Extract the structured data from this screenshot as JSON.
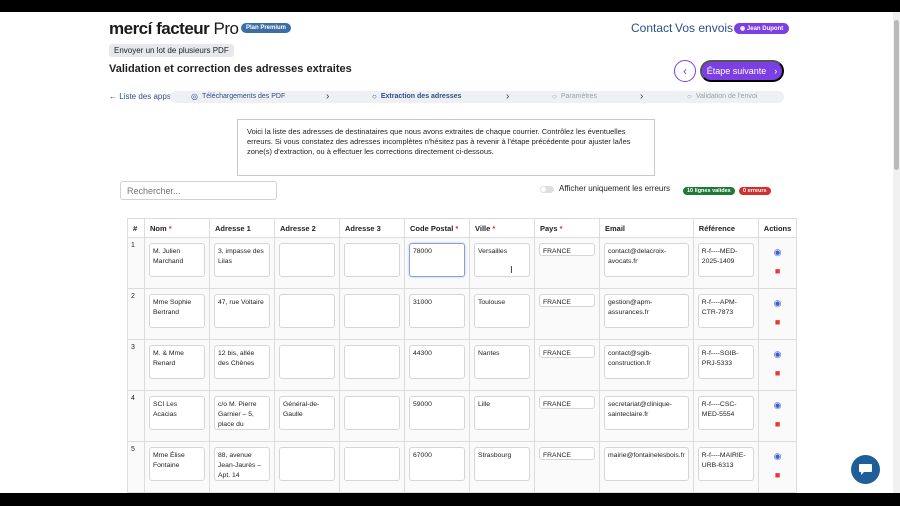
{
  "header": {
    "logo_main": "mercí facteur",
    "logo_pro": " Pro",
    "plan_badge": "Plan Premium",
    "nav": [
      "Contact",
      "Vos envois"
    ],
    "user": "Jean Dupont",
    "user_icon": "user-icon"
  },
  "page": {
    "upload_pill": "Envoyer un lot de plusieurs PDF",
    "title": "Validation et correction des adresses extraites",
    "back_icon": "chevron-left-icon",
    "next_label": "Étape suivante",
    "next_icon": "chevron-right-icon"
  },
  "stepper": {
    "apps_link": "Liste des apps",
    "steps": [
      {
        "label": "Téléchargements des PDF",
        "state": "done"
      },
      {
        "label": "Extraction des adresses",
        "state": "active"
      },
      {
        "label": "Paramètres",
        "state": "future"
      },
      {
        "label": "Validation de l'envoi",
        "state": "future"
      }
    ]
  },
  "info": {
    "line1": "Voici la liste des adresses de destinataires que nous avons extraites de chaque courrier. Contrôlez les éventuelles",
    "line2": "erreurs. Si vous constatez des adresses incomplètes n'hésitez pas à revenir à l'étape précédente pour ajuster la/les",
    "line3": "zone(s) d'extraction, ou à effectuer les corrections directement ci-dessous."
  },
  "filters": {
    "search_placeholder": "Rechercher...",
    "toggle_label": "Afficher uniquement les erreurs",
    "valid_count": "10 lignes valides",
    "error_count": "0 erreurs"
  },
  "table": {
    "columns": [
      {
        "label": "#",
        "required": false
      },
      {
        "label": "Nom",
        "required": true
      },
      {
        "label": "Adresse 1",
        "required": false
      },
      {
        "label": "Adresse 2",
        "required": false
      },
      {
        "label": "Adresse 3",
        "required": false
      },
      {
        "label": "Code Postal",
        "required": true
      },
      {
        "label": "Ville",
        "required": true
      },
      {
        "label": "Pays",
        "required": true
      },
      {
        "label": "Email",
        "required": false
      },
      {
        "label": "Référence",
        "required": false
      },
      {
        "label": "Actions",
        "required": false
      }
    ],
    "rows": [
      {
        "n": "1",
        "nom": "M. Julien Marchand",
        "a1": "3, impasse des Lilas",
        "a2": "",
        "a3": "",
        "cp": "78000",
        "ville": "Versailles",
        "pays": "FRANCE",
        "email": "contact@delacroix-avocats.fr",
        "ref": "R-f----MED-2025-1409"
      },
      {
        "n": "2",
        "nom": "Mme Sophie Bertrand",
        "a1": "47, rue Voltaire",
        "a2": "",
        "a3": "",
        "cp": "31000",
        "ville": "Toulouse",
        "pays": "FRANCE",
        "email": "gestion@apm-assurances.fr",
        "ref": "R-f----APM-CTR-7873"
      },
      {
        "n": "3",
        "nom": "M. & Mme Renard",
        "a1": "12 bis, allée des Chênes",
        "a2": "",
        "a3": "",
        "cp": "44300",
        "ville": "Nantes",
        "pays": "FRANCE",
        "email": "contact@sgib-construction.fr",
        "ref": "R-f----SGIB-PRJ-5333"
      },
      {
        "n": "4",
        "nom": "SCI Les Acacias",
        "a1": "c/o M. Pierre Garnier – 5, place du",
        "a2": "Général-de-Gaulle",
        "a3": "",
        "cp": "59000",
        "ville": "Lille",
        "pays": "FRANCE",
        "email": "secretariat@clinique-sainteclaire.fr",
        "ref": "R-f----CSC-MED-5554"
      },
      {
        "n": "5",
        "nom": "Mme Élise Fontaine",
        "a1": "88, avenue Jean-Jaurès – Apt. 14",
        "a2": "",
        "a3": "",
        "cp": "67000",
        "ville": "Strasbourg",
        "pays": "FRANCE",
        "email": "mairie@fontainelesbois.fr",
        "ref": "R-f----MAIRIE-URB-6313"
      }
    ],
    "action_icons": [
      "eye-icon",
      "trash-icon"
    ]
  },
  "chat_icon": "chat-bubble-icon"
}
